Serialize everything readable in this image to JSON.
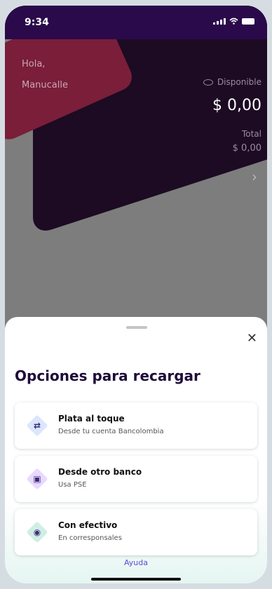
{
  "status": {
    "time": "9:34"
  },
  "home": {
    "greeting_line1": "Hola,",
    "greeting_line2": "Manucalle",
    "available_label": "Disponible",
    "available_amount": "$ 0,00",
    "total_label": "Total",
    "total_amount": "$ 0,00"
  },
  "sheet": {
    "title": "Opciones para recargar",
    "options": [
      {
        "title": "Plata al toque",
        "subtitle": "Desde tu cuenta Bancolombia",
        "icon": "transfer-arrows-icon",
        "icon_color": "#dbe6ff"
      },
      {
        "title": "Desde otro banco",
        "subtitle": "Usa PSE",
        "icon": "wallet-icon",
        "icon_color": "#e9d8ff"
      },
      {
        "title": "Con efectivo",
        "subtitle": "En corresponsales",
        "icon": "cash-icon",
        "icon_color": "#cfeee6"
      }
    ],
    "help_label": "Ayuda"
  },
  "colors": {
    "status_bar": "#2a0a4a",
    "dark_card": "#1c0b22",
    "accent_red": "#7a1e3a",
    "title_text": "#1f0b3a",
    "link": "#5a4bd6"
  }
}
